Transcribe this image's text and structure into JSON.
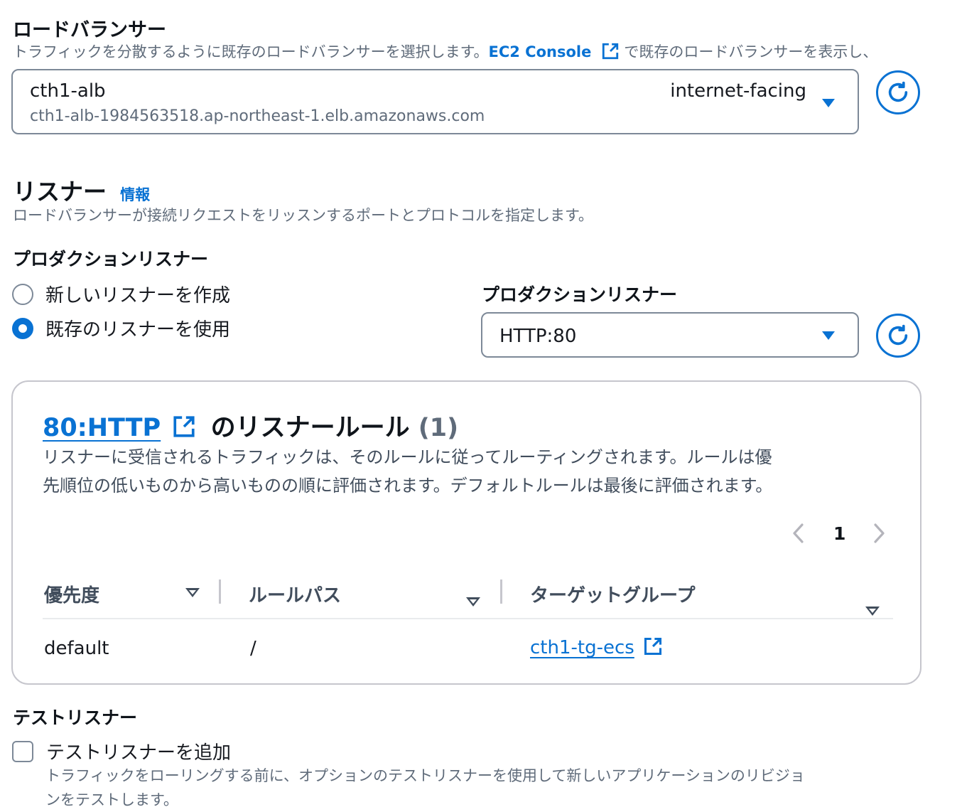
{
  "load_balancer": {
    "heading": "ロードバランサー",
    "description_before": "トラフィックを分散するように既存のロードバランサーを選択します。",
    "console_link": "EC2 Console",
    "description_after": "で既存のロードバランサーを表示し、",
    "selected_name": "cth1-alb",
    "selected_dns": "cth1-alb-1984563518.ap-northeast-1.elb.amazonaws.com",
    "selected_scheme": "internet-facing"
  },
  "listener": {
    "heading": "リスナー",
    "info_link": "情報",
    "description": "ロードバランサーが接続リクエストをリッスンするポートとプロトコルを指定します。",
    "production_heading": "プロダクションリスナー",
    "radio_new": "新しいリスナーを作成",
    "radio_existing": "既存のリスナーを使用",
    "select_label": "プロダクションリスナー",
    "select_value": "HTTP:80"
  },
  "rules_card": {
    "title_link": "80:HTTP",
    "title_suffix": "のリスナールール",
    "count": "(1)",
    "description_line1": "リスナーに受信されるトラフィックは、そのルールに従ってルーティングされます。ルールは優",
    "description_line2": "先順位の低いものから高いものの順に評価されます。デフォルトルールは最後に評価されます。",
    "page_number": "1",
    "columns": [
      "優先度",
      "ルールパス",
      "ターゲットグループ"
    ],
    "rows": [
      {
        "priority": "default",
        "path": "/",
        "target_group": "cth1-tg-ecs"
      }
    ]
  },
  "test_listener": {
    "heading": "テストリスナー",
    "checkbox_label": "テストリスナーを追加",
    "description_line1": "トラフィックをローリングする前に、オプションのテストリスナーを使用して新しいアプリケーションのリビジョ",
    "description_line2": "ンをテストします。"
  },
  "colors": {
    "accent": "#0972d3",
    "text": "#16191f",
    "muted": "#5f6b7a",
    "border": "#7d8998",
    "card_border": "#c6c6cd"
  }
}
